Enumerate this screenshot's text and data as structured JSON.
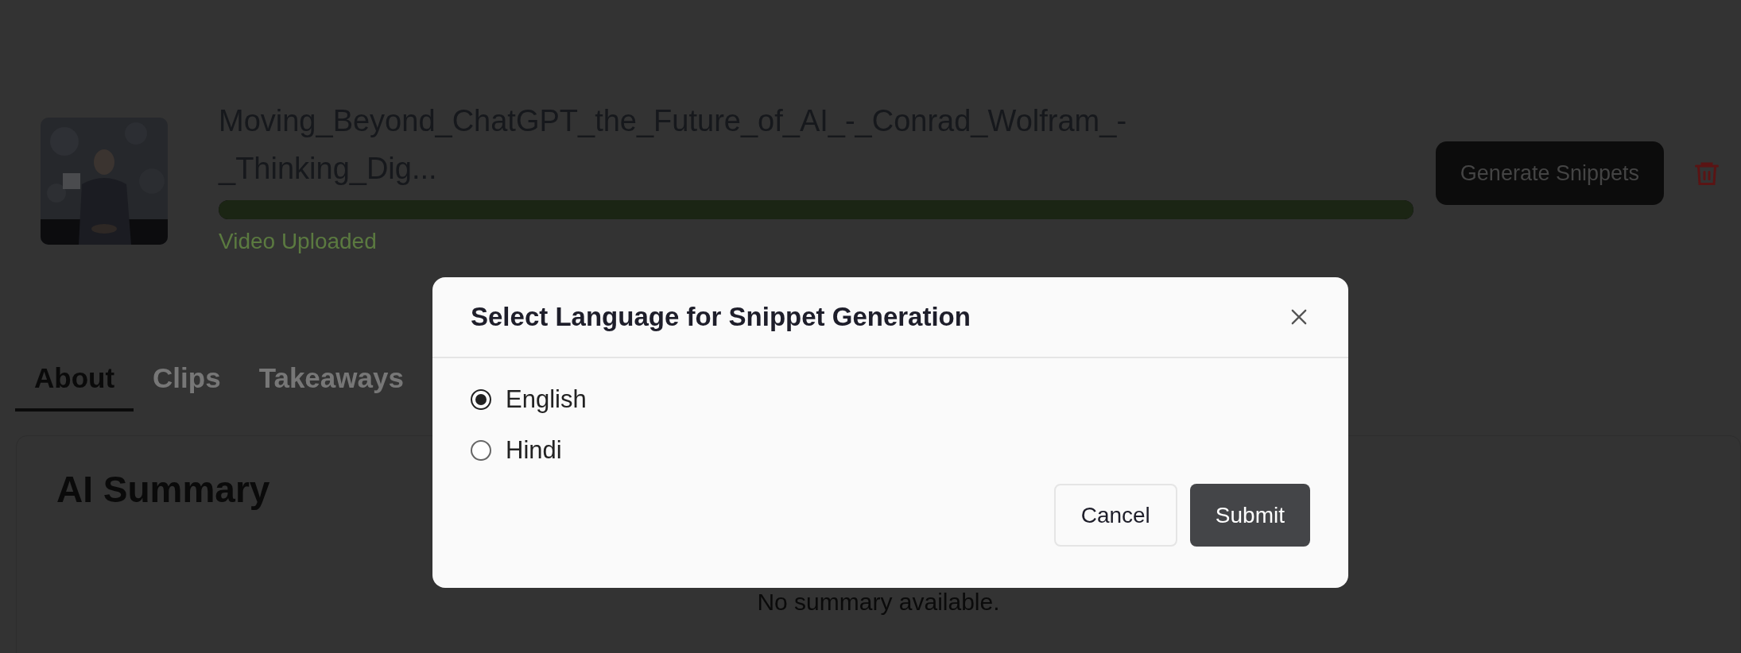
{
  "video": {
    "title": "Moving_Beyond_ChatGPT_the_Future_of_AI_-_Conrad_Wolfram_-_Thinking_Dig...",
    "progress": {
      "level": 1
    },
    "status": "Video Uploaded"
  },
  "actions": {
    "generate": "Generate Snippets"
  },
  "tabs": [
    {
      "label": "About",
      "selected": true
    },
    {
      "label": "Clips",
      "selected": false
    },
    {
      "label": "Takeaways",
      "selected": false
    }
  ],
  "summary": {
    "title": "AI Summary",
    "empty_text": "No summary available."
  },
  "dialog": {
    "title": "Select Language for Snippet Generation",
    "options": [
      {
        "label": "English",
        "selected": true
      },
      {
        "label": "Hindi",
        "selected": false
      }
    ],
    "buttons": [
      {
        "label": "Cancel",
        "kind": "secondary"
      },
      {
        "label": "Submit",
        "kind": "primary"
      }
    ]
  }
}
